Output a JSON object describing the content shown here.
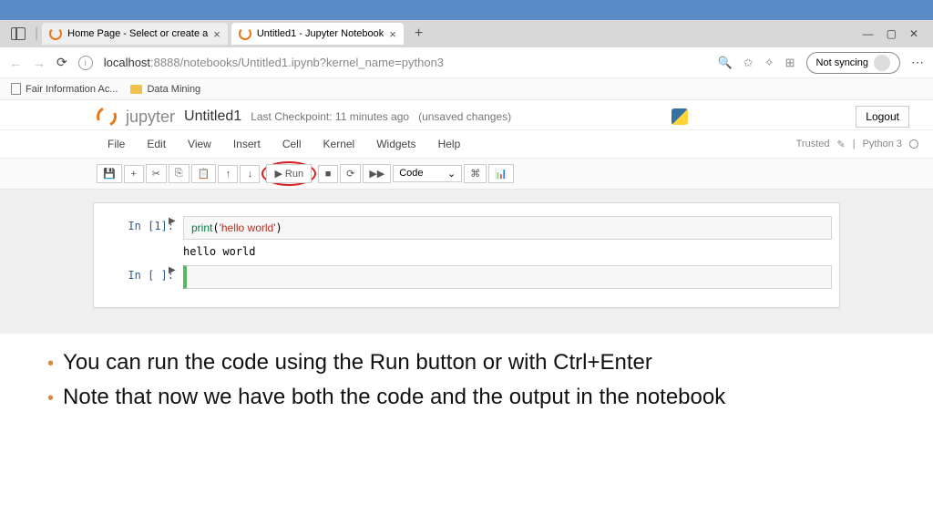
{
  "browser": {
    "tabs": [
      {
        "title": "Home Page - Select or create a ",
        "active": false
      },
      {
        "title": "Untitled1 - Jupyter Notebook",
        "active": true
      }
    ],
    "url_host": "localhost",
    "url_path": ":8888/notebooks/Untitled1.ipynb?kernel_name=python3",
    "sync": "Not syncing",
    "bookmarks": [
      {
        "label": "Fair Information Ac...",
        "kind": "page"
      },
      {
        "label": "Data Mining",
        "kind": "folder"
      }
    ]
  },
  "jupyter": {
    "brand": "jupyter",
    "filename": "Untitled1",
    "checkpoint": "Last Checkpoint: 11 minutes ago",
    "unsaved": "(unsaved changes)",
    "logout": "Logout",
    "menus": [
      "File",
      "Edit",
      "View",
      "Insert",
      "Cell",
      "Kernel",
      "Widgets",
      "Help"
    ],
    "trusted": "Trusted",
    "kernel": "Python 3",
    "toolbar": {
      "run": "Run",
      "celltype": "Code"
    },
    "cells": [
      {
        "prompt": "In [1]:",
        "code_fn": "print",
        "code_str": "'hello world'",
        "output": "hello world"
      },
      {
        "prompt": "In [ ]:",
        "code": ""
      }
    ]
  },
  "slide": {
    "bullets": [
      "You can run the code using the Run button or with Ctrl+Enter",
      "Note that now we have both the code and the output in the notebook"
    ]
  }
}
